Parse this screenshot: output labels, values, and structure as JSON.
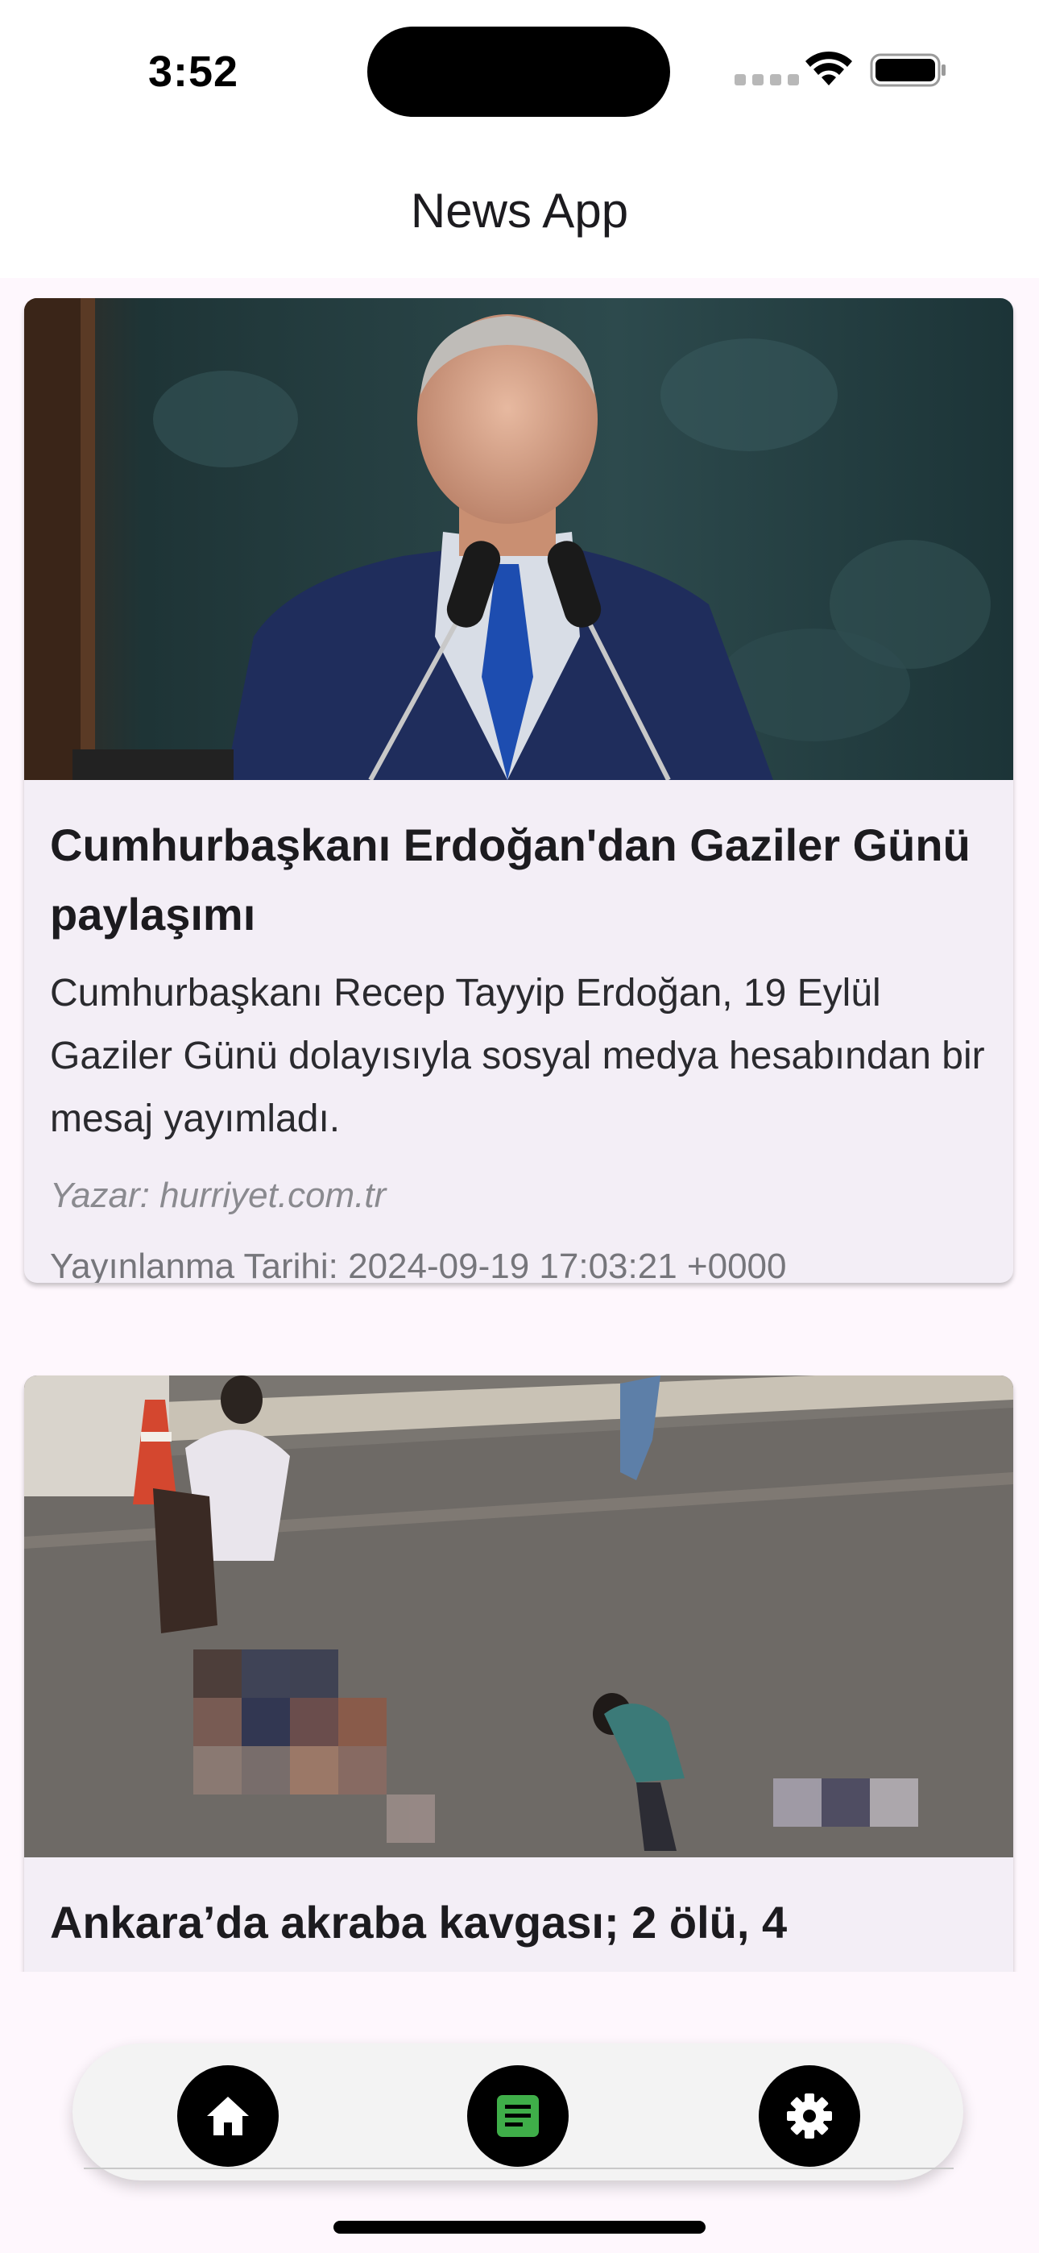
{
  "status_bar": {
    "time": "3:52"
  },
  "app_bar": {
    "title": "News App"
  },
  "articles": [
    {
      "image_alt": "Speaker at podium with microphones",
      "headline": "Cumhurbaşkanı Erdoğan'dan Gaziler Günü paylaşımı",
      "summary": "Cumhurbaşkanı Recep Tayyip Erdoğan, 19 Eylül Gaziler Günü dolayısıyla sosyal medya hesabından bir mesaj yayımladı.",
      "author": "Yazar: hurriyet.com.tr",
      "published": "Yayınlanma Tarihi: 2024-09-19 17:03:21 +0000"
    },
    {
      "image_alt": "Street scene viewed from above",
      "headline": "Ankara’da akraba kavgası; 2 ölü, 4"
    }
  ],
  "bottom_nav": {
    "items": [
      {
        "icon": "home-icon",
        "color": "#ffffff"
      },
      {
        "icon": "article-icon",
        "color": "#3fae49"
      },
      {
        "icon": "gear-icon",
        "color": "#ffffff"
      }
    ]
  },
  "colors": {
    "background": "#fef7fd",
    "card": "#f3eef6",
    "nav_button": "#000000",
    "active_accent": "#3fae49"
  }
}
